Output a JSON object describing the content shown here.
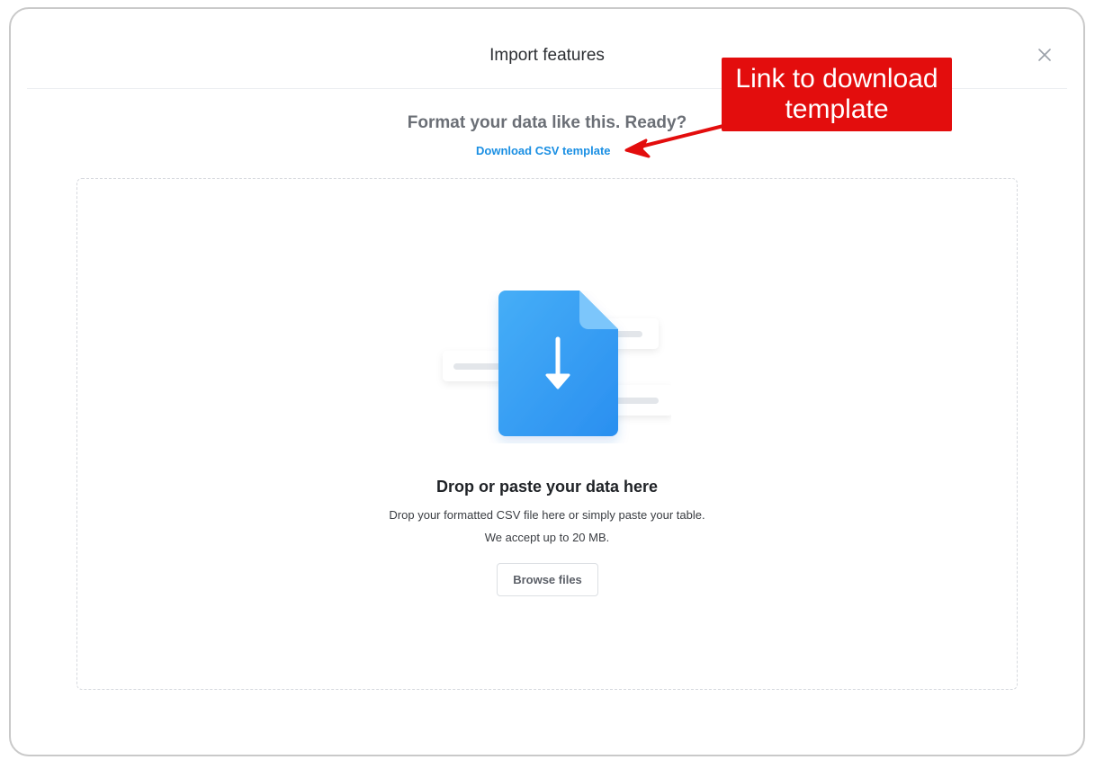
{
  "modal": {
    "title": "Import features",
    "close_icon": "close-icon"
  },
  "format": {
    "heading": "Format your data like this. Ready?",
    "download_link": "Download CSV template"
  },
  "annotation": {
    "text": "Link to download template",
    "color": "#e30d0d"
  },
  "dropzone": {
    "illustration_icon": "file-download-icon",
    "title": "Drop or paste your data here",
    "description": "Drop your formatted CSV file here or simply paste your table.",
    "limit": "We accept up to 20 MB.",
    "browse_button": "Browse files"
  },
  "colors": {
    "accent": "#1a8fe3",
    "file_icon": "#2f9cf5"
  }
}
